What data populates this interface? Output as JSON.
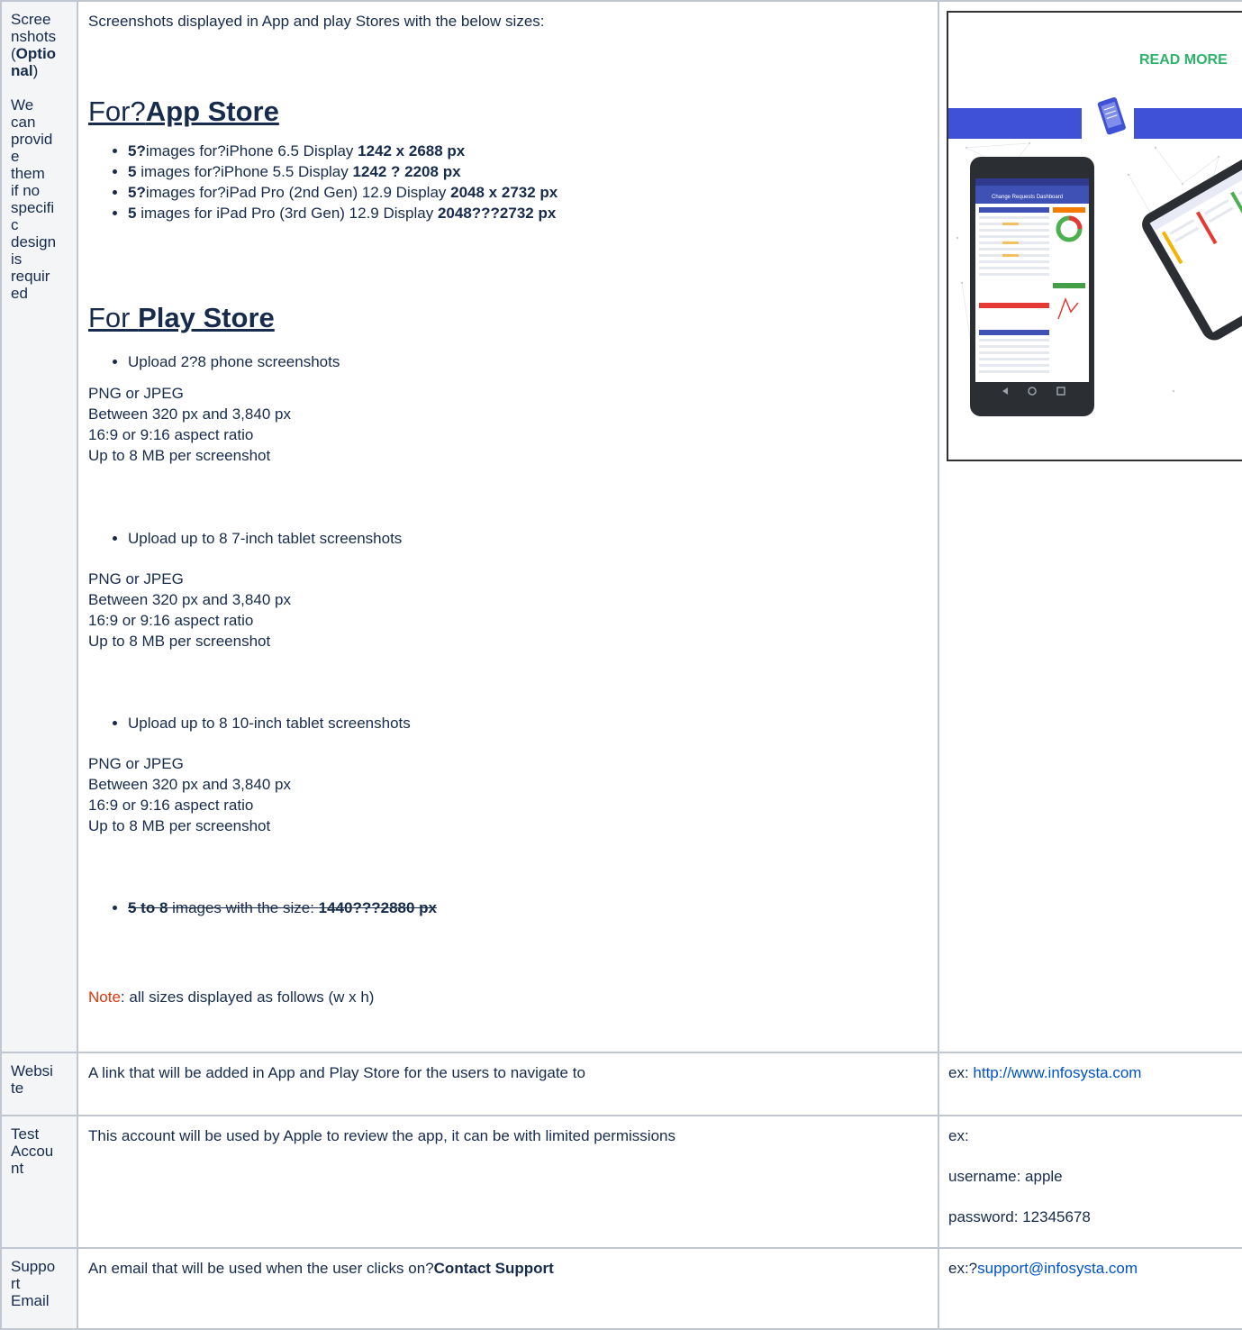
{
  "screenshots": {
    "label": [
      "Scree",
      "nshots",
      "(",
      "Optio",
      "nal",
      ")"
    ],
    "note": [
      "We",
      "can",
      "provid",
      "e",
      "them",
      "if no",
      "specifi",
      "c",
      "design",
      "is",
      "requir",
      "ed"
    ],
    "intro": "Screenshots displayed in App and play Stores with the below sizes:",
    "app_store": {
      "heading_prefix": "For?",
      "heading_bold": "App Store",
      "items": [
        {
          "lead": "5?",
          "text": "images for?iPhone 6.5 Display ",
          "size": "1242 x 2688 px"
        },
        {
          "lead": "5",
          "text": " images for?iPhone 5.5 Display ",
          "size": "1242 ? 2208 px"
        },
        {
          "lead": "5?",
          "text": "images for?iPad Pro (2nd Gen) 12.9 Display ",
          "size": "2048 x 2732 px"
        },
        {
          "lead": "5",
          "text": " images for iPad Pro (3rd Gen) 12.9 Display ",
          "size": "2048???2732 px"
        }
      ]
    },
    "play_store": {
      "heading_prefix": "For ",
      "heading_bold": "Play Store",
      "groups": [
        {
          "bullet": "Upload 2?8 phone screenshots",
          "lines": [
            "PNG or JPEG",
            "Between 320 px and 3,840 px",
            "16:9 or 9:16 aspect ratio",
            "Up to 8 MB per screenshot"
          ]
        },
        {
          "bullet": "Upload up to 8 7-inch tablet screenshots",
          "lines": [
            "PNG or JPEG",
            "Between 320 px and 3,840 px",
            "16:9 or 9:16 aspect ratio",
            "Up to 8 MB per screenshot"
          ]
        },
        {
          "bullet": "Upload up to 8 10-inch tablet screenshots",
          "lines": [
            "PNG or JPEG",
            "Between 320 px and 3,840 px",
            "16:9 or 9:16 aspect ratio",
            "Up to 8 MB per screenshot"
          ]
        }
      ],
      "struck": {
        "lead": "5 to 8",
        "text": " images with the size: ",
        "size": "1440???2880 px"
      }
    },
    "note_label": "Note",
    "note_text": ": all sizes displayed as follows (w x h)",
    "image_caption": "READ MORE",
    "image_topbar": "Change Requests Dashboard"
  },
  "website": {
    "label": [
      "Websi",
      "te"
    ],
    "desc": "A link that will be added in App and Play Store for the users to navigate to",
    "ex_prefix": "ex: ",
    "link": "http://www.infosysta.com"
  },
  "test_account": {
    "label": [
      "Test",
      "Accou",
      "nt"
    ],
    "desc": "This account will be used by Apple to review the app, it can be with limited permissions",
    "ex": "ex:",
    "username": "username: apple",
    "password": "password: 12345678"
  },
  "support": {
    "label": [
      "Suppo",
      "rt",
      "Email"
    ],
    "desc_prefix": "An email that will be used when the user clicks on?",
    "desc_bold": "Contact Support",
    "ex_prefix": "ex:?",
    "email": "support@infosysta.com"
  },
  "colors": {
    "border": "#c1c7d0",
    "header_bg": "#f4f5f7",
    "link": "#0052cc",
    "note_red": "#de350b",
    "banner_blue": "#3f51d6"
  }
}
